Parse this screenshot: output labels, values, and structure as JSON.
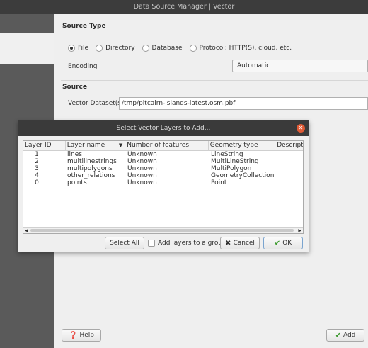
{
  "window": {
    "title": "Data Source Manager | Vector"
  },
  "source_type": {
    "title": "Source Type",
    "options": [
      {
        "label": "File",
        "selected": true
      },
      {
        "label": "Directory",
        "selected": false
      },
      {
        "label": "Database",
        "selected": false
      },
      {
        "label": "Protocol: HTTP(S), cloud, etc.",
        "selected": false
      }
    ],
    "encoding_label": "Encoding",
    "encoding_value": "Automatic"
  },
  "source": {
    "title": "Source",
    "dataset_label": "Vector Dataset(s)",
    "dataset_value": "/tmp/pitcairn-islands-latest.osm.pbf"
  },
  "dialog": {
    "title": "Select Vector Layers to Add...",
    "columns": [
      "Layer ID",
      "Layer name",
      "Number of features",
      "Geometry type",
      "Description"
    ],
    "rows": [
      {
        "id": "1",
        "name": "lines",
        "features": "Unknown",
        "geometry": "LineString"
      },
      {
        "id": "2",
        "name": "multilinestrings",
        "features": "Unknown",
        "geometry": "MultiLineString"
      },
      {
        "id": "3",
        "name": "multipolygons",
        "features": "Unknown",
        "geometry": "MultiPolygon"
      },
      {
        "id": "4",
        "name": "other_relations",
        "features": "Unknown",
        "geometry": "GeometryCollection"
      },
      {
        "id": "0",
        "name": "points",
        "features": "Unknown",
        "geometry": "Point"
      }
    ],
    "select_all": "Select All",
    "add_to_group": "Add layers to a group",
    "cancel": "Cancel",
    "ok": "OK"
  },
  "footer": {
    "help": "Help",
    "add": "Add"
  }
}
